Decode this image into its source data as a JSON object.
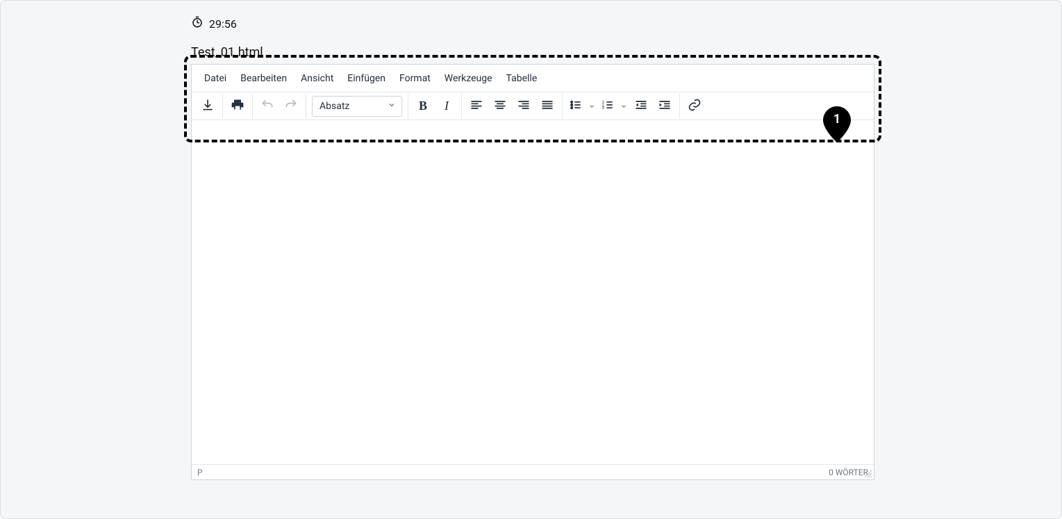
{
  "timer": {
    "value": "29:56"
  },
  "filename": "Test_01.html",
  "menubar": {
    "file": "Datei",
    "edit": "Bearbeiten",
    "view": "Ansicht",
    "insert": "Einfügen",
    "format": "Format",
    "tools": "Werkzeuge",
    "table": "Tabelle"
  },
  "toolbar": {
    "block_format": "Absatz"
  },
  "statusbar": {
    "path": "P",
    "wordcount": "0 WÖRTER"
  },
  "annotation": {
    "marker": "1"
  }
}
